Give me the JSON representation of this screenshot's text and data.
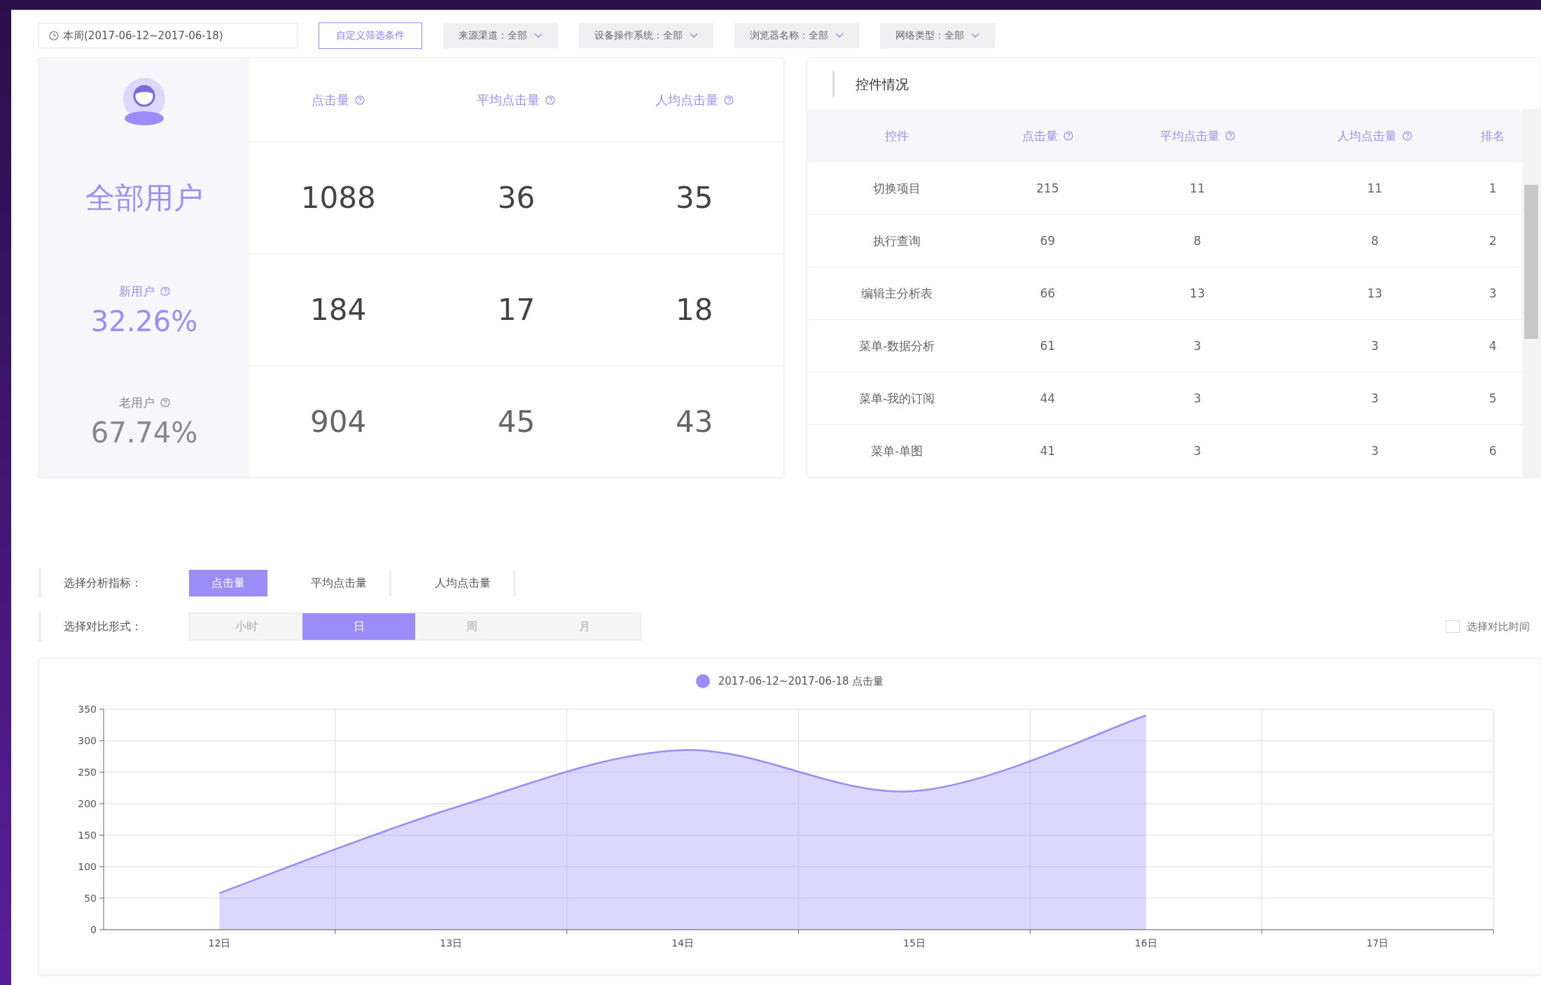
{
  "filters": {
    "date_range": "本周(2017-06-12~2017-06-18)",
    "custom_button": "自定义筛选条件",
    "dropdowns": [
      {
        "label": "来源渠道：全部"
      },
      {
        "label": "设备操作系统：全部"
      },
      {
        "label": "浏览器名称：全部"
      },
      {
        "label": "网络类型：全部"
      }
    ]
  },
  "summary": {
    "columns": [
      "点击量",
      "平均点击量",
      "人均点击量"
    ],
    "rows": [
      {
        "kind": "all",
        "label": "全部用户",
        "values": [
          "1088",
          "36",
          "35"
        ]
      },
      {
        "kind": "new",
        "label": "新用户",
        "percent": "32.26%",
        "values": [
          "184",
          "17",
          "18"
        ]
      },
      {
        "kind": "old",
        "label": "老用户",
        "percent": "67.74%",
        "values": [
          "904",
          "45",
          "43"
        ]
      }
    ]
  },
  "controls_table": {
    "title": "控件情况",
    "columns": [
      {
        "label": "控件",
        "help": false
      },
      {
        "label": "点击量",
        "help": true
      },
      {
        "label": "平均点击量",
        "help": true
      },
      {
        "label": "人均点击量",
        "help": true
      },
      {
        "label": "排名",
        "help": false
      }
    ],
    "rows": [
      [
        "切换项目",
        "215",
        "11",
        "11",
        "1"
      ],
      [
        "执行查询",
        "69",
        "8",
        "8",
        "2"
      ],
      [
        "编辑主分析表",
        "66",
        "13",
        "13",
        "3"
      ],
      [
        "菜单-数据分析",
        "61",
        "3",
        "3",
        "4"
      ],
      [
        "菜单-我的订阅",
        "44",
        "3",
        "3",
        "5"
      ],
      [
        "菜单-单图",
        "41",
        "3",
        "3",
        "6"
      ]
    ]
  },
  "metric_selector": {
    "label": "选择分析指标：",
    "options": [
      {
        "label": "点击量",
        "selected": true
      },
      {
        "label": "平均点击量",
        "selected": false
      },
      {
        "label": "人均点击量",
        "selected": false
      }
    ]
  },
  "period_selector": {
    "label": "选择对比形式：",
    "options": [
      {
        "label": "小时",
        "selected": false
      },
      {
        "label": "日",
        "selected": true
      },
      {
        "label": "周",
        "selected": false
      },
      {
        "label": "月",
        "selected": false
      }
    ]
  },
  "compare_time": {
    "label": "选择对比时间",
    "checked": false
  },
  "chart": {
    "chart_data": {
      "type": "area",
      "categories": [
        "12日",
        "13日",
        "14日",
        "15日",
        "16日",
        "17日"
      ],
      "series": [
        {
          "name": "2017-06-12~2017-06-18 点击量",
          "color": "#9b8cf7",
          "values": [
            58,
            192,
            285,
            220,
            340,
            null
          ]
        }
      ],
      "grid": true,
      "ylim": [
        0,
        350
      ],
      "yticks": [
        0,
        50,
        100,
        150,
        200,
        250,
        300,
        350
      ]
    }
  }
}
